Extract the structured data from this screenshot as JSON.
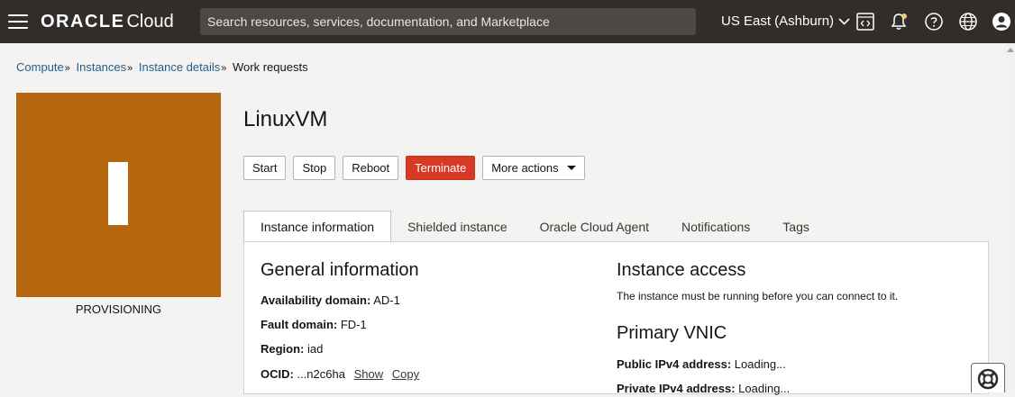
{
  "header": {
    "brand_oracle": "ORACLE",
    "brand_cloud": "Cloud",
    "search_placeholder": "Search resources, services, documentation, and Marketplace",
    "region": "US East (Ashburn)",
    "icons": [
      "menu-icon",
      "code-editor-icon",
      "bell-icon",
      "help-icon",
      "globe-icon",
      "user-icon"
    ]
  },
  "breadcrumb": {
    "items": [
      "Compute",
      "Instances",
      "Instance details"
    ],
    "current": "Work requests",
    "separator": "»"
  },
  "instance": {
    "initial": "I",
    "state": "PROVISIONING",
    "name": "LinuxVM",
    "tile_color": "#b4670e"
  },
  "actions": {
    "start": "Start",
    "stop": "Stop",
    "reboot": "Reboot",
    "terminate": "Terminate",
    "more": "More actions"
  },
  "tabs": [
    "Instance information",
    "Shielded instance",
    "Oracle Cloud Agent",
    "Notifications",
    "Tags"
  ],
  "general": {
    "heading": "General information",
    "availability_label": "Availability domain:",
    "availability_value": "AD-1",
    "fault_label": "Fault domain:",
    "fault_value": "FD-1",
    "region_label": "Region:",
    "region_value": "iad",
    "ocid_label": "OCID:",
    "ocid_value": "...n2c6ha",
    "show": "Show",
    "copy": "Copy"
  },
  "access": {
    "heading": "Instance access",
    "note": "The instance must be running before you can connect to it."
  },
  "vnic": {
    "heading": "Primary VNIC",
    "public_label": "Public IPv4 address:",
    "public_value": "Loading...",
    "private_label": "Private IPv4 address:",
    "private_value": "Loading..."
  },
  "colors": {
    "topbar": "#312d2a",
    "link": "#1f5f8b",
    "danger": "#d73925"
  }
}
